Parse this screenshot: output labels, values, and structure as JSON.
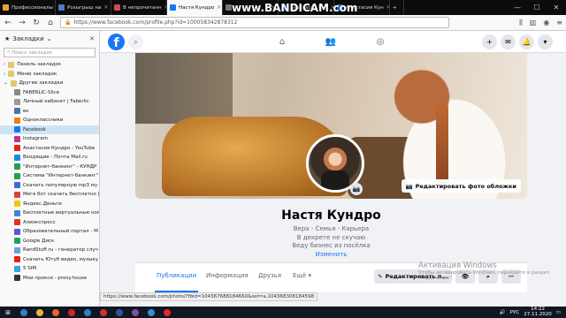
{
  "browser": {
    "tabs": [
      {
        "label": "Профессионалы",
        "color": "#e8a33b"
      },
      {
        "label": "Розыгрыш на",
        "color": "#4a7bd0"
      },
      {
        "label": "В непрочитанн",
        "color": "#d04a4a"
      },
      {
        "label": "Настя Кундро",
        "color": "#1877f2",
        "active": true
      },
      {
        "label": "",
        "color": "#777"
      },
      {
        "label": "Анастасия Куп",
        "color": "#1877f2"
      },
      {
        "label": "Анастасия Кун",
        "color": "#1877f2"
      }
    ],
    "overlay_text": "www.BANDICAM.com",
    "url": "https://www.facebook.com/profile.php?id=100058342878312",
    "status_url": "https://www.facebook.com/photo/?fbid=104367688184660&set=a.104368308184598"
  },
  "sidebar": {
    "title": "Закладки",
    "search_placeholder": "Поиск закладок",
    "folders": [
      {
        "label": "Панель закладок",
        "arrow": "›"
      },
      {
        "label": "Меню закладок",
        "arrow": "›"
      },
      {
        "label": "Другие закладки",
        "arrow": "⌄"
      }
    ],
    "items": [
      {
        "label": "FABERLIC-Slice",
        "color": "#888"
      },
      {
        "label": "Личный кабинет | Faberlic",
        "color": "#999"
      },
      {
        "label": "вк",
        "color": "#4a76a8"
      },
      {
        "label": "Одноклассники",
        "color": "#ee8208"
      },
      {
        "label": "Facebook",
        "color": "#1877f2",
        "selected": true
      },
      {
        "label": "Instagram",
        "color": "#c13584"
      },
      {
        "label": "Анастасия Кундро - YouTube",
        "color": "#e62117"
      },
      {
        "label": "Входящие - Почта Mail.ru",
        "color": "#168de2"
      },
      {
        "label": "\"Интернет-банкинг\" - КУНДР",
        "color": "#2a9d4a"
      },
      {
        "label": "Система \"Интернет-банкинг\"",
        "color": "#2a9d4a"
      },
      {
        "label": "Скачать популярную mp3 му",
        "color": "#3b6bd6"
      },
      {
        "label": "Мега бот скачать бесплатно |",
        "color": "#d6423b"
      },
      {
        "label": "Яндекс.Деньги",
        "color": "#f6c300"
      },
      {
        "label": "Бесплатные виртуальные ном",
        "color": "#3b86d6"
      },
      {
        "label": "Алиэкспресс",
        "color": "#e43225"
      },
      {
        "label": "Образовательный портал - М",
        "color": "#5a5ad6"
      },
      {
        "label": "Google Диск",
        "color": "#1fa463"
      },
      {
        "label": "RandStuff.ru - генератор случ",
        "color": "#6aa0e0"
      },
      {
        "label": "Скачать Ютуб видео, музыку",
        "color": "#e62117"
      },
      {
        "label": "5 SIM",
        "color": "#3ca0e0"
      },
      {
        "label": "Мои прокси - proxy.house",
        "color": "#333"
      }
    ]
  },
  "facebook": {
    "logo": "f",
    "cover_button": "Редактировать фото обложки",
    "name": "Настя Кундро",
    "bio": [
      "Вера - Семья - Карьера",
      "В декрете не скучаю",
      "Веду бизнес из посёлка"
    ],
    "edit_link": "Изменить",
    "tabs": [
      "Публикации",
      "Информация",
      "Друзья",
      "Ещё ▾"
    ],
    "edit_profile": "Редактировать п...",
    "watermark_title": "Активация Windows",
    "watermark_sub": "Чтобы активировать Windows, перейдите в раздел \"Параметры\"."
  },
  "taskbar": {
    "lang": "РУС",
    "time": "14:22",
    "date": "27.11.2020"
  }
}
